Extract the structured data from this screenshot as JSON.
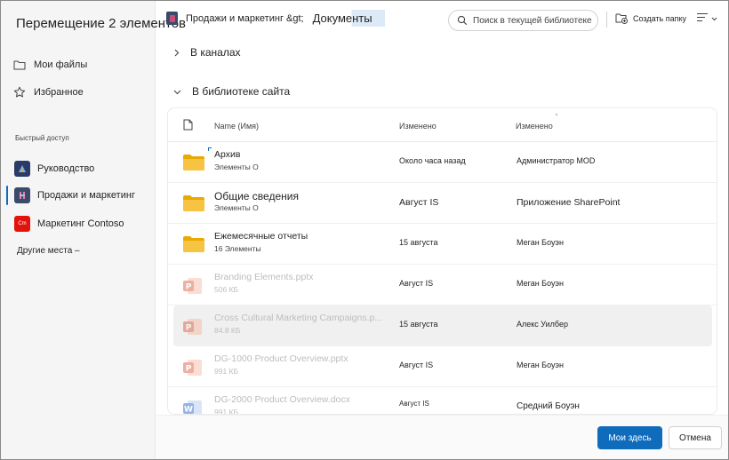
{
  "dialog": {
    "title": "Перемещение 2 элементов"
  },
  "sidebar": {
    "items": [
      {
        "label": "Мои файлы",
        "icon": "folder-icon"
      },
      {
        "label": "Избранное",
        "icon": "star-icon"
      }
    ],
    "quick_access_label": "Быстрый доступ",
    "quick_access": [
      {
        "label": "Руководство",
        "icon_color": "#2b3a67"
      },
      {
        "label": "Продажи и маркетинг",
        "icon_color": "#3a4a6b",
        "selected": true
      },
      {
        "label": "Маркетинг Contoso",
        "icon_color": "#e3120b",
        "icon_text": "Cm"
      }
    ],
    "other_places": "Другие  места –"
  },
  "header": {
    "breadcrumb_parent": "Продажи и маркетинг &gt;",
    "breadcrumb_current": "Документы",
    "search_placeholder": "Поиск в текущей библиотеке",
    "new_folder_label": "Создать папку"
  },
  "sections": {
    "channels": "В каналах",
    "site_library": "В библиотеке сайта"
  },
  "columns": {
    "name": "Name (Имя)",
    "modified": "Изменено",
    "modified_by": "Изменено"
  },
  "rows": [
    {
      "name": "Архив",
      "sub": "Элементы О",
      "modified": "Около часа назад",
      "modified_by": "Администратор MOD",
      "type": "folder",
      "dim": false
    },
    {
      "name": "Общие сведения",
      "sub": "Элементы О",
      "modified": "Август IS",
      "modified_by": "Приложение SharePoint",
      "type": "folder",
      "dim": false
    },
    {
      "name": "Ежемесячные отчеты",
      "sub": "16 Элементы",
      "modified": "15 августа",
      "modified_by": "Меган Боуэн",
      "type": "folder",
      "dim": false
    },
    {
      "name": "Branding Elements.pptx",
      "sub": "506 КБ",
      "modified": "Август   IS",
      "modified_by": "Меган Боуэн",
      "type": "pptx",
      "dim": true
    },
    {
      "name": "Cross Cultural Marketing Campaigns.p...",
      "sub": "84.8 КБ",
      "modified": "15 августа",
      "modified_by": "Алекс Уилбер",
      "type": "pptx",
      "dim": true,
      "highlight": true
    },
    {
      "name": "DG-1000 Product Overview.pptx",
      "sub": "991 КБ",
      "modified": "Август IS",
      "modified_by": "Меган Боуэн",
      "type": "pptx",
      "dim": true
    },
    {
      "name": "DG-2000 Product Overview.docx",
      "sub": "991 КБ",
      "modified": "Август    IS",
      "modified_by": "Средний Боуэн",
      "type": "docx",
      "dim": true
    }
  ],
  "footer": {
    "primary": "Мои здесь",
    "secondary": "Отмена"
  },
  "colors": {
    "accent": "#0f6cbd",
    "folder": "#f6c342",
    "pptx": "#d35230",
    "docx": "#185abd"
  }
}
